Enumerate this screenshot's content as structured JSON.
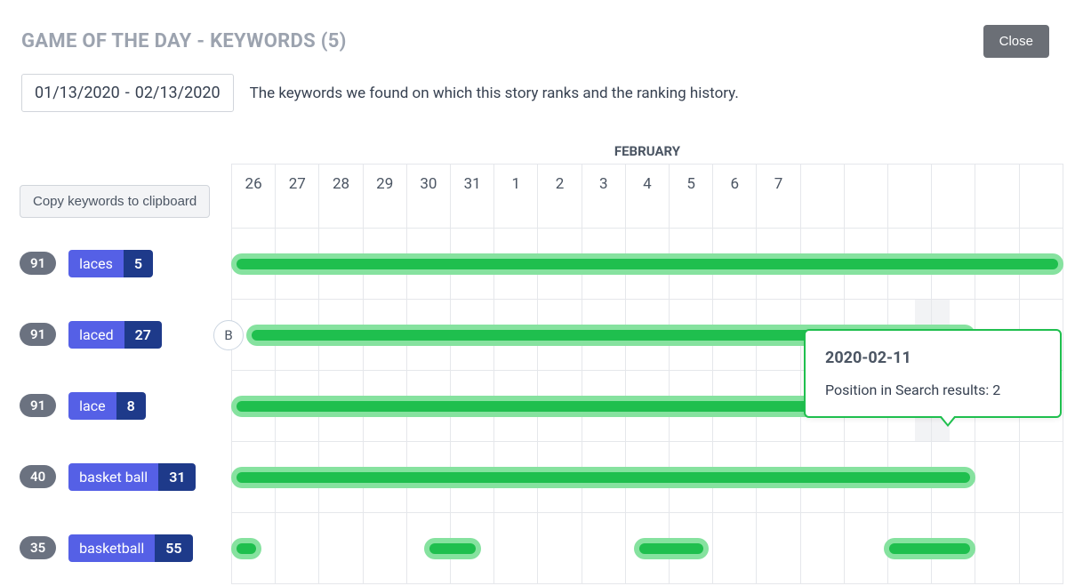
{
  "header": {
    "title": "GAME OF THE DAY - KEYWORDS (5)",
    "close_label": "Close"
  },
  "date_range": {
    "start": "01/13/2020",
    "separator": "-",
    "end": "02/13/2020"
  },
  "description": "The keywords we found on which this story ranks and the ranking history.",
  "copy_label": "Copy keywords to clipboard",
  "timeline": {
    "month_label": "FEBRUARY",
    "days": [
      "26",
      "27",
      "28",
      "29",
      "30",
      "31",
      "1",
      "2",
      "3",
      "4",
      "5",
      "6",
      "7"
    ],
    "total_columns_visible": 19,
    "hover_column_index": 16
  },
  "tooltip": {
    "date": "2020-02-11",
    "label": "Position in Search results:",
    "value": "2"
  },
  "keywords": [
    {
      "score": "91",
      "name": "laces",
      "rank": "5",
      "bars": [
        {
          "start": 0,
          "end": 19
        }
      ],
      "marker": null
    },
    {
      "score": "91",
      "name": "laced",
      "rank": "27",
      "bars": [
        {
          "start": 0.35,
          "end": 17
        }
      ],
      "marker": "B"
    },
    {
      "score": "91",
      "name": "lace",
      "rank": "8",
      "bars": [
        {
          "start": 0,
          "end": 17
        }
      ],
      "marker": null
    },
    {
      "score": "40",
      "name": "basket ball",
      "rank": "31",
      "bars": [
        {
          "start": 0,
          "end": 17
        }
      ],
      "marker": null
    },
    {
      "score": "35",
      "name": "basketball",
      "rank": "55",
      "bars": [
        {
          "start": 0,
          "end": 0.7
        },
        {
          "start": 4.4,
          "end": 5.7
        },
        {
          "start": 9.2,
          "end": 10.9
        },
        {
          "start": 14.9,
          "end": 17
        }
      ],
      "marker": null
    }
  ],
  "colors": {
    "bar_outer": "#86e29f",
    "bar_inner": "#1fbf4e",
    "kw_name_bg": "#5560e6",
    "kw_val_bg": "#1e3a8a",
    "score_pill": "#6b7280",
    "tooltip_border": "#1fbf4e"
  }
}
